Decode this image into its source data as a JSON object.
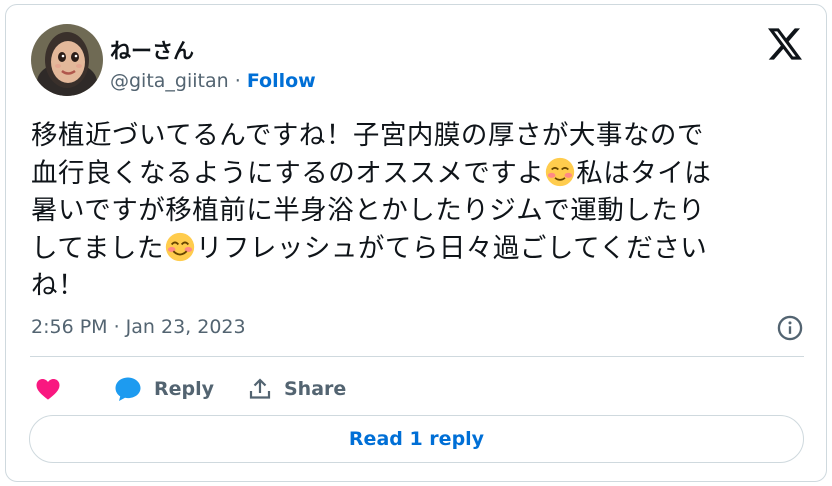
{
  "author": {
    "display_name": "ねーさん",
    "handle": "@gita_giitan",
    "separator": " · ",
    "follow_label": "Follow"
  },
  "tweet": {
    "line1": "移植近づいてるんですね！子宮内膜の厚さが大事なので",
    "line2a": "血行良くなるようにするのオススメですよ",
    "line2b": "私はタイは",
    "line3": "暑いですが移植前に半身浴とかしたりジムで運動したり",
    "line4a": "してました",
    "line4b": "リフレッシュがてら日々過ごしてください",
    "line5": "ね！",
    "emoji1": "smiling-face-with-smiling-eyes",
    "emoji2": "smiling-face-with-blush"
  },
  "timestamp": "2:56 PM · Jan 23, 2023",
  "actions": {
    "reply_label": "Reply",
    "share_label": "Share"
  },
  "read_replies_label": "Read 1 reply",
  "colors": {
    "accent": "#006fd6",
    "like": "#f91880",
    "reply_icon": "#1d9bf0",
    "muted": "#536471",
    "border": "#cfd9de"
  }
}
